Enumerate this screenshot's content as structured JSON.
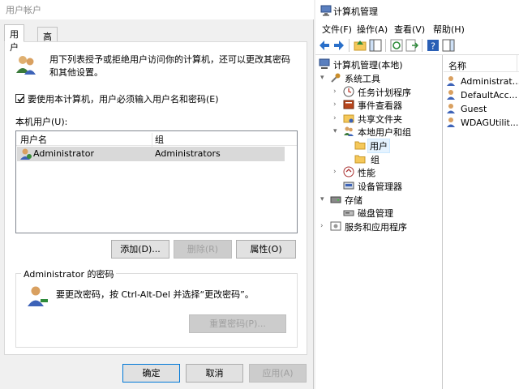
{
  "user_accounts": {
    "title": "用户帐户",
    "tabs": [
      {
        "label": "用户"
      },
      {
        "label": "高级"
      }
    ],
    "description": "用下列表授予或拒绝用户访问你的计算机，还可以更改其密码和其他设置。",
    "require_login_checkbox": {
      "label": "要使用本计算机，用户必须输入用户名和密码(E)",
      "checked": true
    },
    "local_users_label": "本机用户(U):",
    "columns": [
      "用户名",
      "组"
    ],
    "rows": [
      {
        "username": "Administrator",
        "group": "Administrators"
      }
    ],
    "buttons": {
      "add": "添加(D)...",
      "remove": "删除(R)",
      "properties": "属性(O)"
    },
    "password_group": {
      "title": "Administrator 的密码",
      "text": "要更改密码，按 Ctrl-Alt-Del 并选择“更改密码”。",
      "reset_button": "重置密码(P)..."
    },
    "footer": {
      "ok": "确定",
      "cancel": "取消",
      "apply": "应用(A)"
    }
  },
  "computer_management": {
    "title": "计算机管理",
    "menu": [
      {
        "label": "文件(F)"
      },
      {
        "label": "操作(A)"
      },
      {
        "label": "查看(V)"
      },
      {
        "label": "帮助(H)"
      }
    ],
    "tree": [
      {
        "label": "计算机管理(本地)"
      },
      {
        "label": "系统工具"
      },
      {
        "label": "任务计划程序"
      },
      {
        "label": "事件查看器"
      },
      {
        "label": "共享文件夹"
      },
      {
        "label": "本地用户和组"
      },
      {
        "label": "用户"
      },
      {
        "label": "组"
      },
      {
        "label": "性能"
      },
      {
        "label": "设备管理器"
      },
      {
        "label": "存储"
      },
      {
        "label": "磁盘管理"
      },
      {
        "label": "服务和应用程序"
      }
    ],
    "list_header": "名称",
    "users": [
      {
        "name": "Administrat..."
      },
      {
        "name": "DefaultAcc..."
      },
      {
        "name": "Guest"
      },
      {
        "name": "WDAGUtilit..."
      }
    ],
    "colors": {
      "selection": "#e5f3ff",
      "folder": "#f5c85a",
      "accent": "#0078d7"
    }
  }
}
